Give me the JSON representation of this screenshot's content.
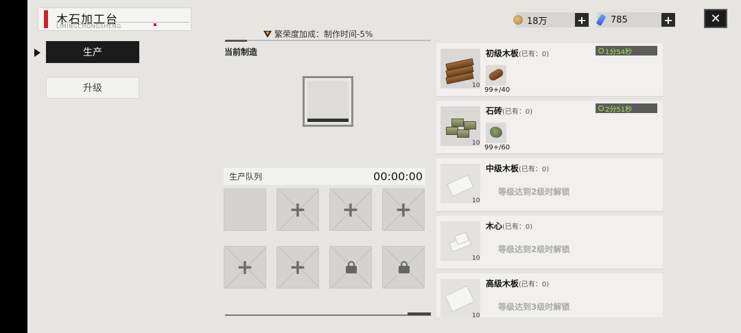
{
  "header": {
    "title": "木石加工台",
    "subtitle": "LIMINGCHONGSHENG"
  },
  "tabs": [
    {
      "label": "生产",
      "active": true
    },
    {
      "label": "升级",
      "active": false
    }
  ],
  "boost": {
    "text": "繁荣度加成：制作时间-5%"
  },
  "current": {
    "label": "当前制造"
  },
  "queue": {
    "title": "生产队列",
    "timer": "00:00:00",
    "plus_symbol": "+"
  },
  "currency": {
    "coins": "18万",
    "gems": "785",
    "plus": "+"
  },
  "close_symbol": "✕",
  "recipes": [
    {
      "name": "初级木板",
      "own": "(已有：0)",
      "count": "10",
      "timer": "1分54秒",
      "material": "99+/40"
    },
    {
      "name": "石砖",
      "own": "(已有：0)",
      "count": "10",
      "timer": "2分51秒",
      "material": "99+/60"
    },
    {
      "name": "中级木板",
      "own": "(已有：0)",
      "count": "10",
      "locked": "等级达到2级时解锁"
    },
    {
      "name": "木心",
      "own": "(已有：0)",
      "count": "10",
      "locked": "等级达到2级时解锁"
    },
    {
      "name": "高级木板",
      "own": "(已有：0)",
      "count": "10",
      "locked": "等级达到3级时解锁"
    }
  ],
  "colors": {
    "accent_red": "#c8242a",
    "timer_green": "#a7e34b",
    "panel_dark": "#1b1b1b"
  }
}
